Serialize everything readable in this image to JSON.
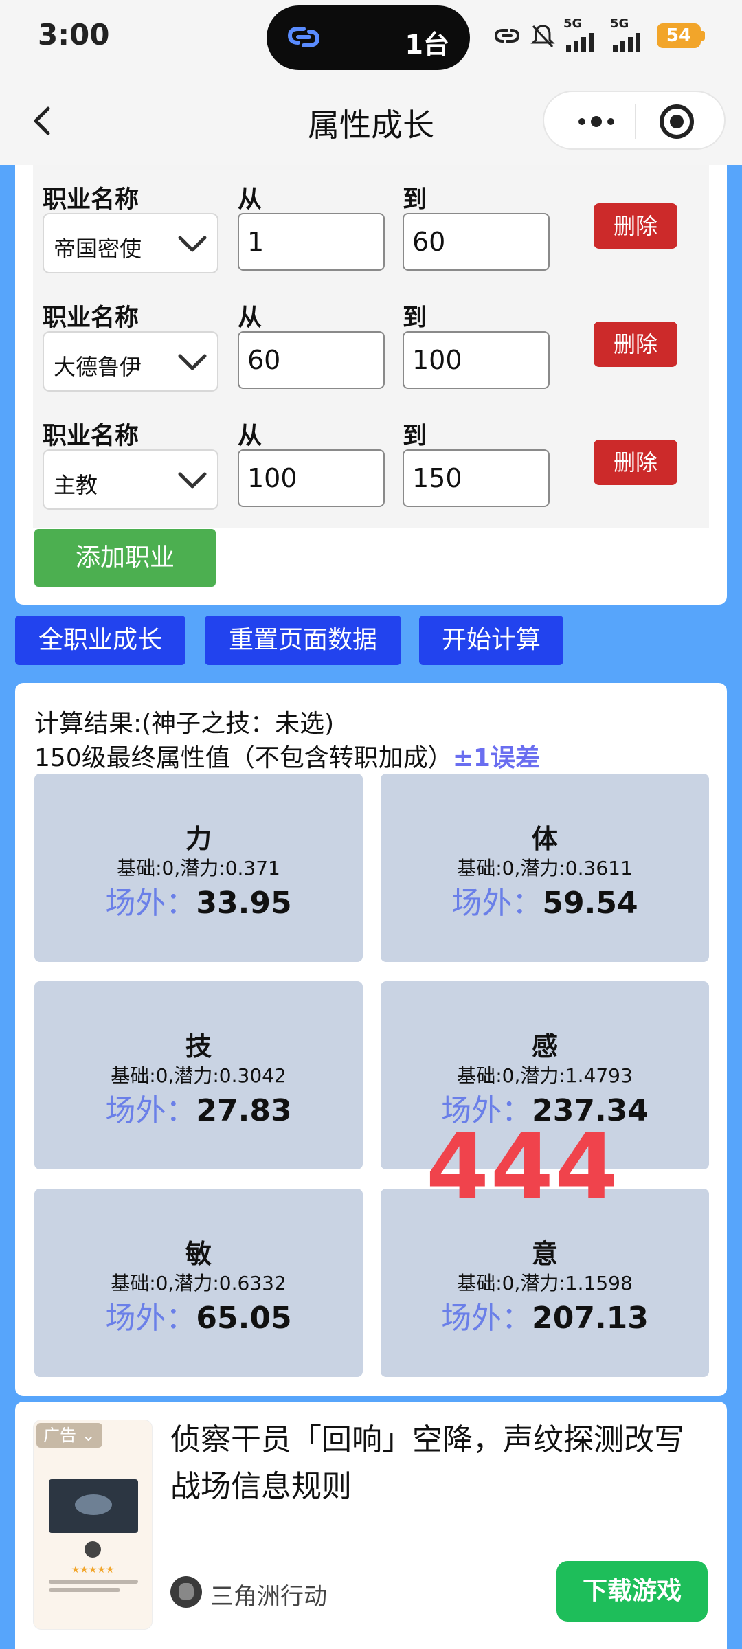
{
  "status_bar": {
    "time": "3:00",
    "island_text": "1台",
    "signal_1": "5G",
    "signal_2": "5G",
    "battery": "54"
  },
  "nav": {
    "title": "属性成长"
  },
  "job_section": {
    "name_label": "职业名称",
    "from_label": "从",
    "to_label": "到",
    "delete_label": "删除",
    "rows": [
      {
        "job": "帝国密使",
        "from": "1",
        "to": "60"
      },
      {
        "job": "大德鲁伊",
        "from": "60",
        "to": "100"
      },
      {
        "job": "主教",
        "from": "100",
        "to": "150"
      }
    ],
    "add_label": "添加职业"
  },
  "actions": {
    "all_growth": "全职业成长",
    "reset": "重置页面数据",
    "calculate": "开始计算"
  },
  "result": {
    "title": "计算结果:(神子之技：未选)",
    "subtitle": "150级最终属性值（不包含转职加成）",
    "error_note": "±1误差",
    "offsite_label": "场外：",
    "stats": [
      {
        "name": "力",
        "detail": "基础:0,潜力:0.371",
        "value": "33.95"
      },
      {
        "name": "体",
        "detail": "基础:0,潜力:0.3611",
        "value": "59.54"
      },
      {
        "name": "技",
        "detail": "基础:0,潜力:0.3042",
        "value": "27.83"
      },
      {
        "name": "感",
        "detail": "基础:0,潜力:1.4793",
        "value": "237.34"
      },
      {
        "name": "敏",
        "detail": "基础:0,潜力:0.6332",
        "value": "65.05"
      },
      {
        "name": "意",
        "detail": "基础:0,潜力:1.1598",
        "value": "207.13"
      }
    ],
    "overlay_number": "444"
  },
  "ad": {
    "tag": "广告",
    "headline": "侦察干员「回响」空降，声纹探测改写战场信息规则",
    "source": "三角洲行动",
    "download_label": "下载游戏"
  }
}
